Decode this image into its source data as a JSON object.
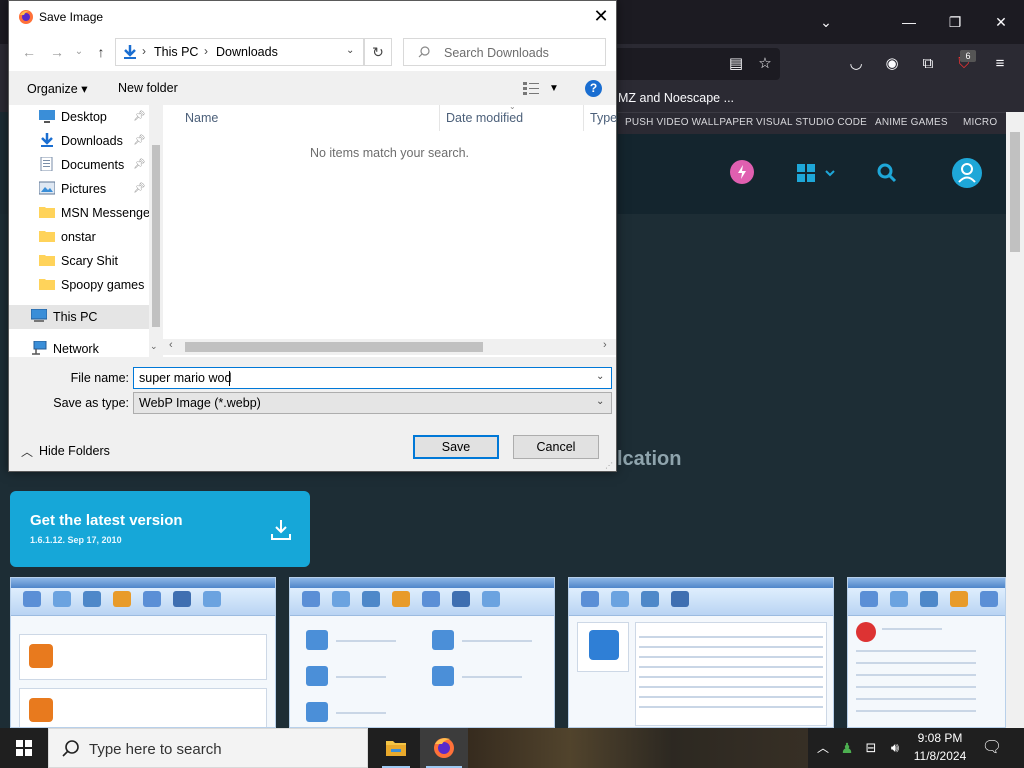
{
  "dialog": {
    "title": "Save Image",
    "close": "✕",
    "address": {
      "crumbs": [
        "This PC",
        "Downloads"
      ]
    },
    "search_placeholder": "Search Downloads",
    "commands": {
      "organize": "Organize ▾",
      "new_folder": "New folder"
    },
    "nav_items": [
      {
        "label": "Desktop",
        "icon": "desktop-icon",
        "pinned": true
      },
      {
        "label": "Downloads",
        "icon": "download-folder-icon",
        "pinned": true
      },
      {
        "label": "Documents",
        "icon": "documents-icon",
        "pinned": true
      },
      {
        "label": "Pictures",
        "icon": "pictures-icon",
        "pinned": true
      },
      {
        "label": "MSN Messenger",
        "icon": "folder-icon",
        "pinned": false
      },
      {
        "label": "onstar",
        "icon": "folder-icon",
        "pinned": false
      },
      {
        "label": "Scary Shit",
        "icon": "folder-icon",
        "pinned": false
      },
      {
        "label": "Spoopy games",
        "icon": "folder-icon",
        "pinned": false
      },
      {
        "label": "This PC",
        "icon": "computer-icon",
        "selected": true
      },
      {
        "label": "Network",
        "icon": "network-icon",
        "pinned": false
      }
    ],
    "columns": [
      "Name",
      "Date modified",
      "Type"
    ],
    "empty_message": "No items match your search.",
    "file_name_label": "File name:",
    "file_name_value": "super mario wod",
    "save_as_type_label": "Save as type:",
    "save_as_type_value": "WebP Image (*.webp)",
    "hide_folders": "Hide Folders",
    "save_button": "Save",
    "cancel_button": "Cancel",
    "colors": {
      "accent": "#0078d7",
      "folder": "#ffd35a"
    }
  },
  "browser": {
    "tab_title": "MZ and Noescape ...",
    "bookmarks": [
      "PUSH VIDEO WALLPAPER",
      "VISUAL STUDIO CODE",
      "ANIME GAMES",
      "MICRO"
    ],
    "extension_badge": "6",
    "heading_fragment": "lcation",
    "latest_card": {
      "title": "Get the latest version",
      "meta": "1.6.1.12.   Sep 17, 2010"
    },
    "colors": {
      "card": "#16a7d8",
      "site_accent": "#1ea7d8",
      "page_bg": "#1d2d35"
    }
  },
  "taskbar": {
    "search_placeholder": "Type here to search",
    "time": "9:08 PM",
    "date": "11/8/2024"
  }
}
